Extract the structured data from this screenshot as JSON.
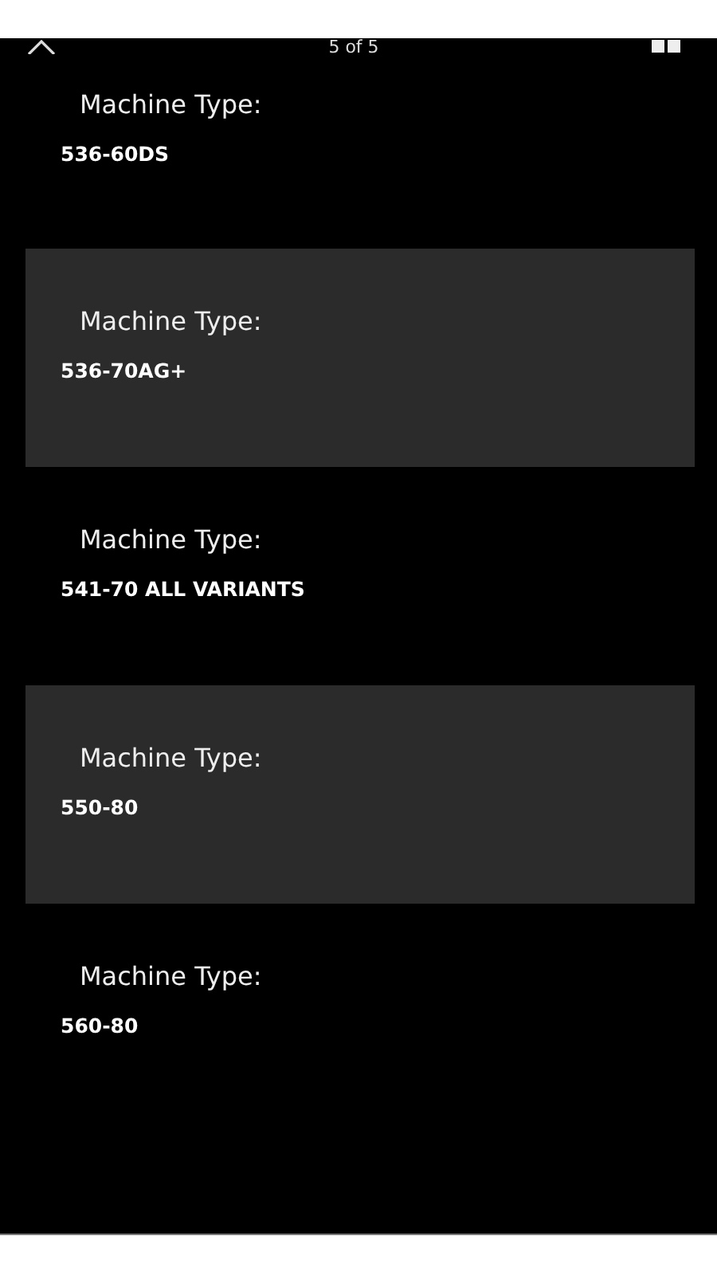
{
  "header": {
    "title": "5 of 5"
  },
  "items": [
    {
      "label": "Machine Type:",
      "value": "536-60DS",
      "shaded": false
    },
    {
      "label": "Machine Type:",
      "value": "536-70AG+",
      "shaded": true
    },
    {
      "label": "Machine Type:",
      "value": "541-70 ALL VARIANTS",
      "shaded": false
    },
    {
      "label": "Machine Type:",
      "value": "550-80",
      "shaded": true
    },
    {
      "label": "Machine Type:",
      "value": "560-80",
      "shaded": false
    }
  ]
}
